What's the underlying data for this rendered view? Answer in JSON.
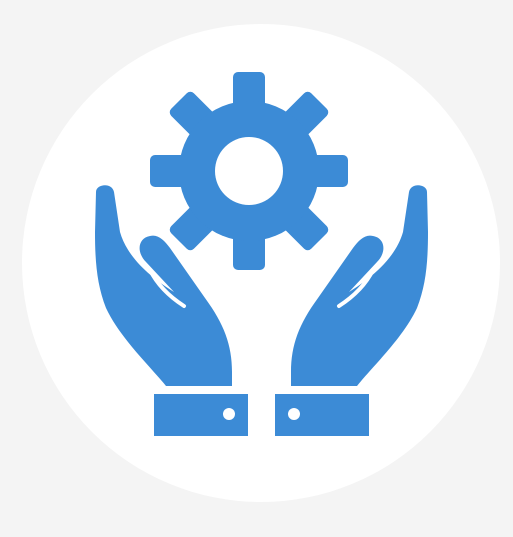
{
  "icon": {
    "name": "hands-holding-gear-icon",
    "colors": {
      "page_background": "#f4f4f4",
      "circle_background": "#ffffff",
      "glyph": "#3c8bd6"
    }
  }
}
